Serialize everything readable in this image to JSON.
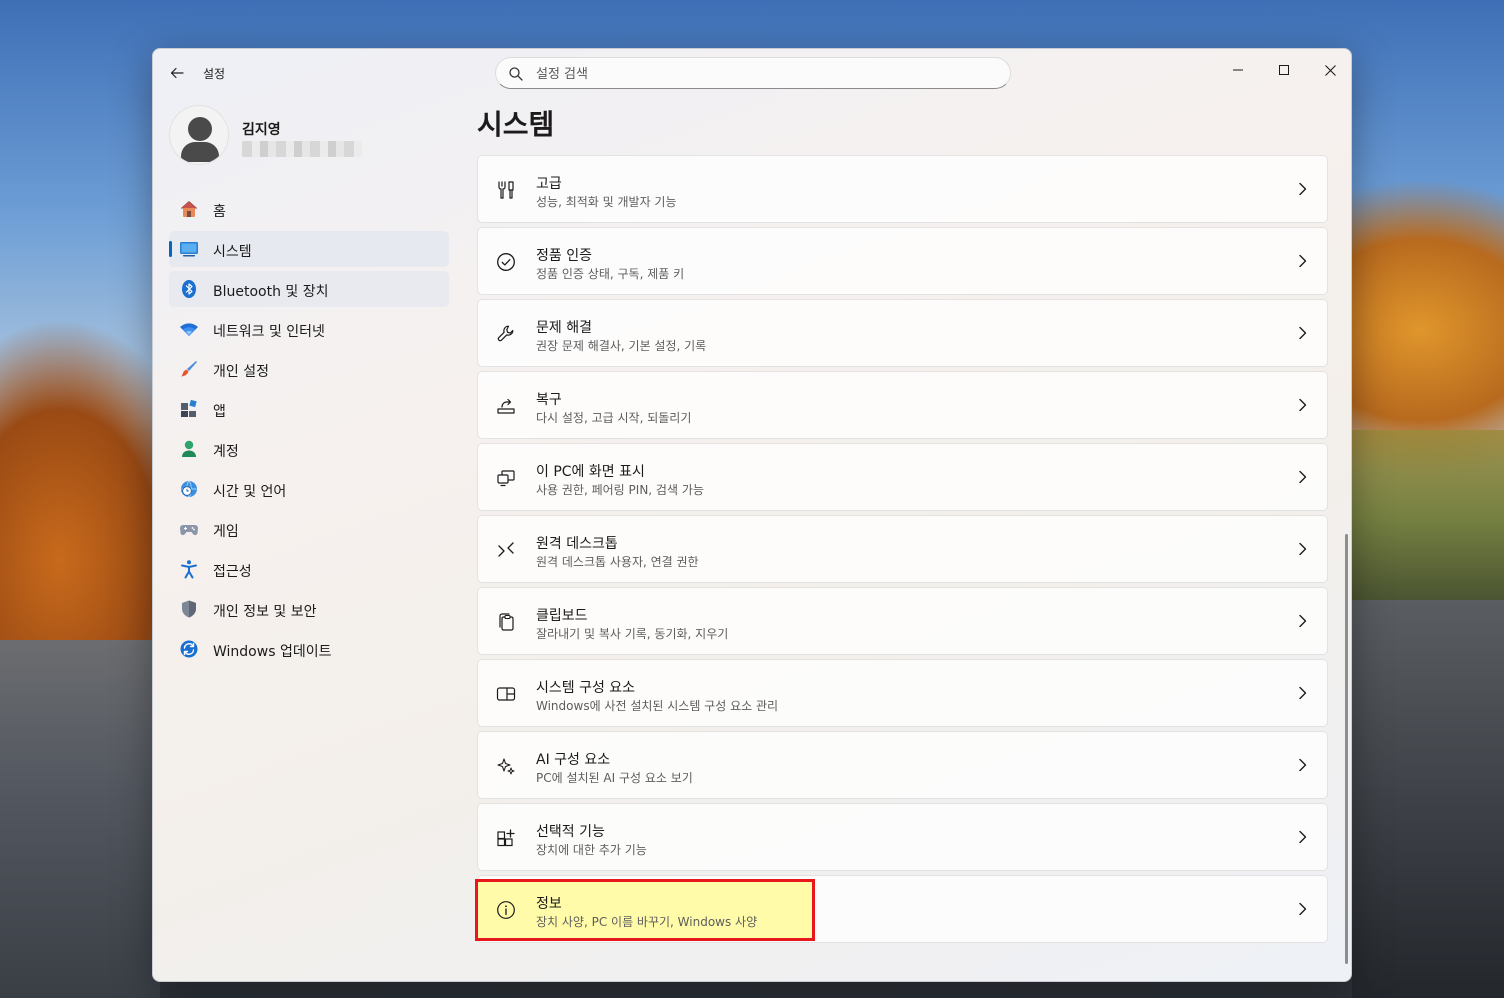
{
  "window": {
    "title": "설정",
    "search_placeholder": "설정 검색"
  },
  "profile": {
    "name": "김지영"
  },
  "nav": [
    {
      "label": "홈",
      "icon": "home-icon"
    },
    {
      "label": "시스템",
      "icon": "system-icon",
      "active": true
    },
    {
      "label": "Bluetooth 및 장치",
      "icon": "bluetooth-icon"
    },
    {
      "label": "네트워크 및 인터넷",
      "icon": "wifi-icon"
    },
    {
      "label": "개인 설정",
      "icon": "brush-icon"
    },
    {
      "label": "앱",
      "icon": "apps-icon"
    },
    {
      "label": "계정",
      "icon": "account-icon"
    },
    {
      "label": "시간 및 언어",
      "icon": "globe-clock-icon"
    },
    {
      "label": "게임",
      "icon": "gamepad-icon"
    },
    {
      "label": "접근성",
      "icon": "accessibility-icon"
    },
    {
      "label": "개인 정보 및 보안",
      "icon": "shield-icon"
    },
    {
      "label": "Windows 업데이트",
      "icon": "update-icon"
    }
  ],
  "page": {
    "title": "시스템"
  },
  "cards": [
    {
      "title": "고급",
      "desc": "성능, 최적화 및 개발자 기능",
      "icon": "tools-icon"
    },
    {
      "title": "정품 인증",
      "desc": "정품 인증 상태, 구독, 제품 키",
      "icon": "check-circle-icon"
    },
    {
      "title": "문제 해결",
      "desc": "권장 문제 해결사, 기본 설정, 기록",
      "icon": "wrench-icon"
    },
    {
      "title": "복구",
      "desc": "다시 설정, 고급 시작, 되돌리기",
      "icon": "recovery-icon"
    },
    {
      "title": "이 PC에 화면 표시",
      "desc": "사용 권한, 페어링 PIN, 검색 가능",
      "icon": "project-icon"
    },
    {
      "title": "원격 데스크톱",
      "desc": "원격 데스크톱 사용자, 연결 권한",
      "icon": "remote-desktop-icon"
    },
    {
      "title": "클립보드",
      "desc": "잘라내기 및 복사 기록, 동기화, 지우기",
      "icon": "clipboard-icon"
    },
    {
      "title": "시스템 구성 요소",
      "desc": "Windows에 사전 설치된 시스템 구성 요소 관리",
      "icon": "components-icon"
    },
    {
      "title": "AI 구성 요소",
      "desc": "PC에 설치된 AI 구성 요소 보기",
      "icon": "sparkle-icon"
    },
    {
      "title": "선택적 기능",
      "desc": "장치에 대한 추가 기능",
      "icon": "optional-features-icon"
    },
    {
      "title": "정보",
      "desc": "장치 사양, PC 이름 바꾸기, Windows 사양",
      "icon": "info-icon",
      "highlighted": true
    }
  ],
  "colors": {
    "accent": "#0067c0",
    "highlight_border": "#e8161d",
    "highlight_fill": "#fffa96"
  }
}
